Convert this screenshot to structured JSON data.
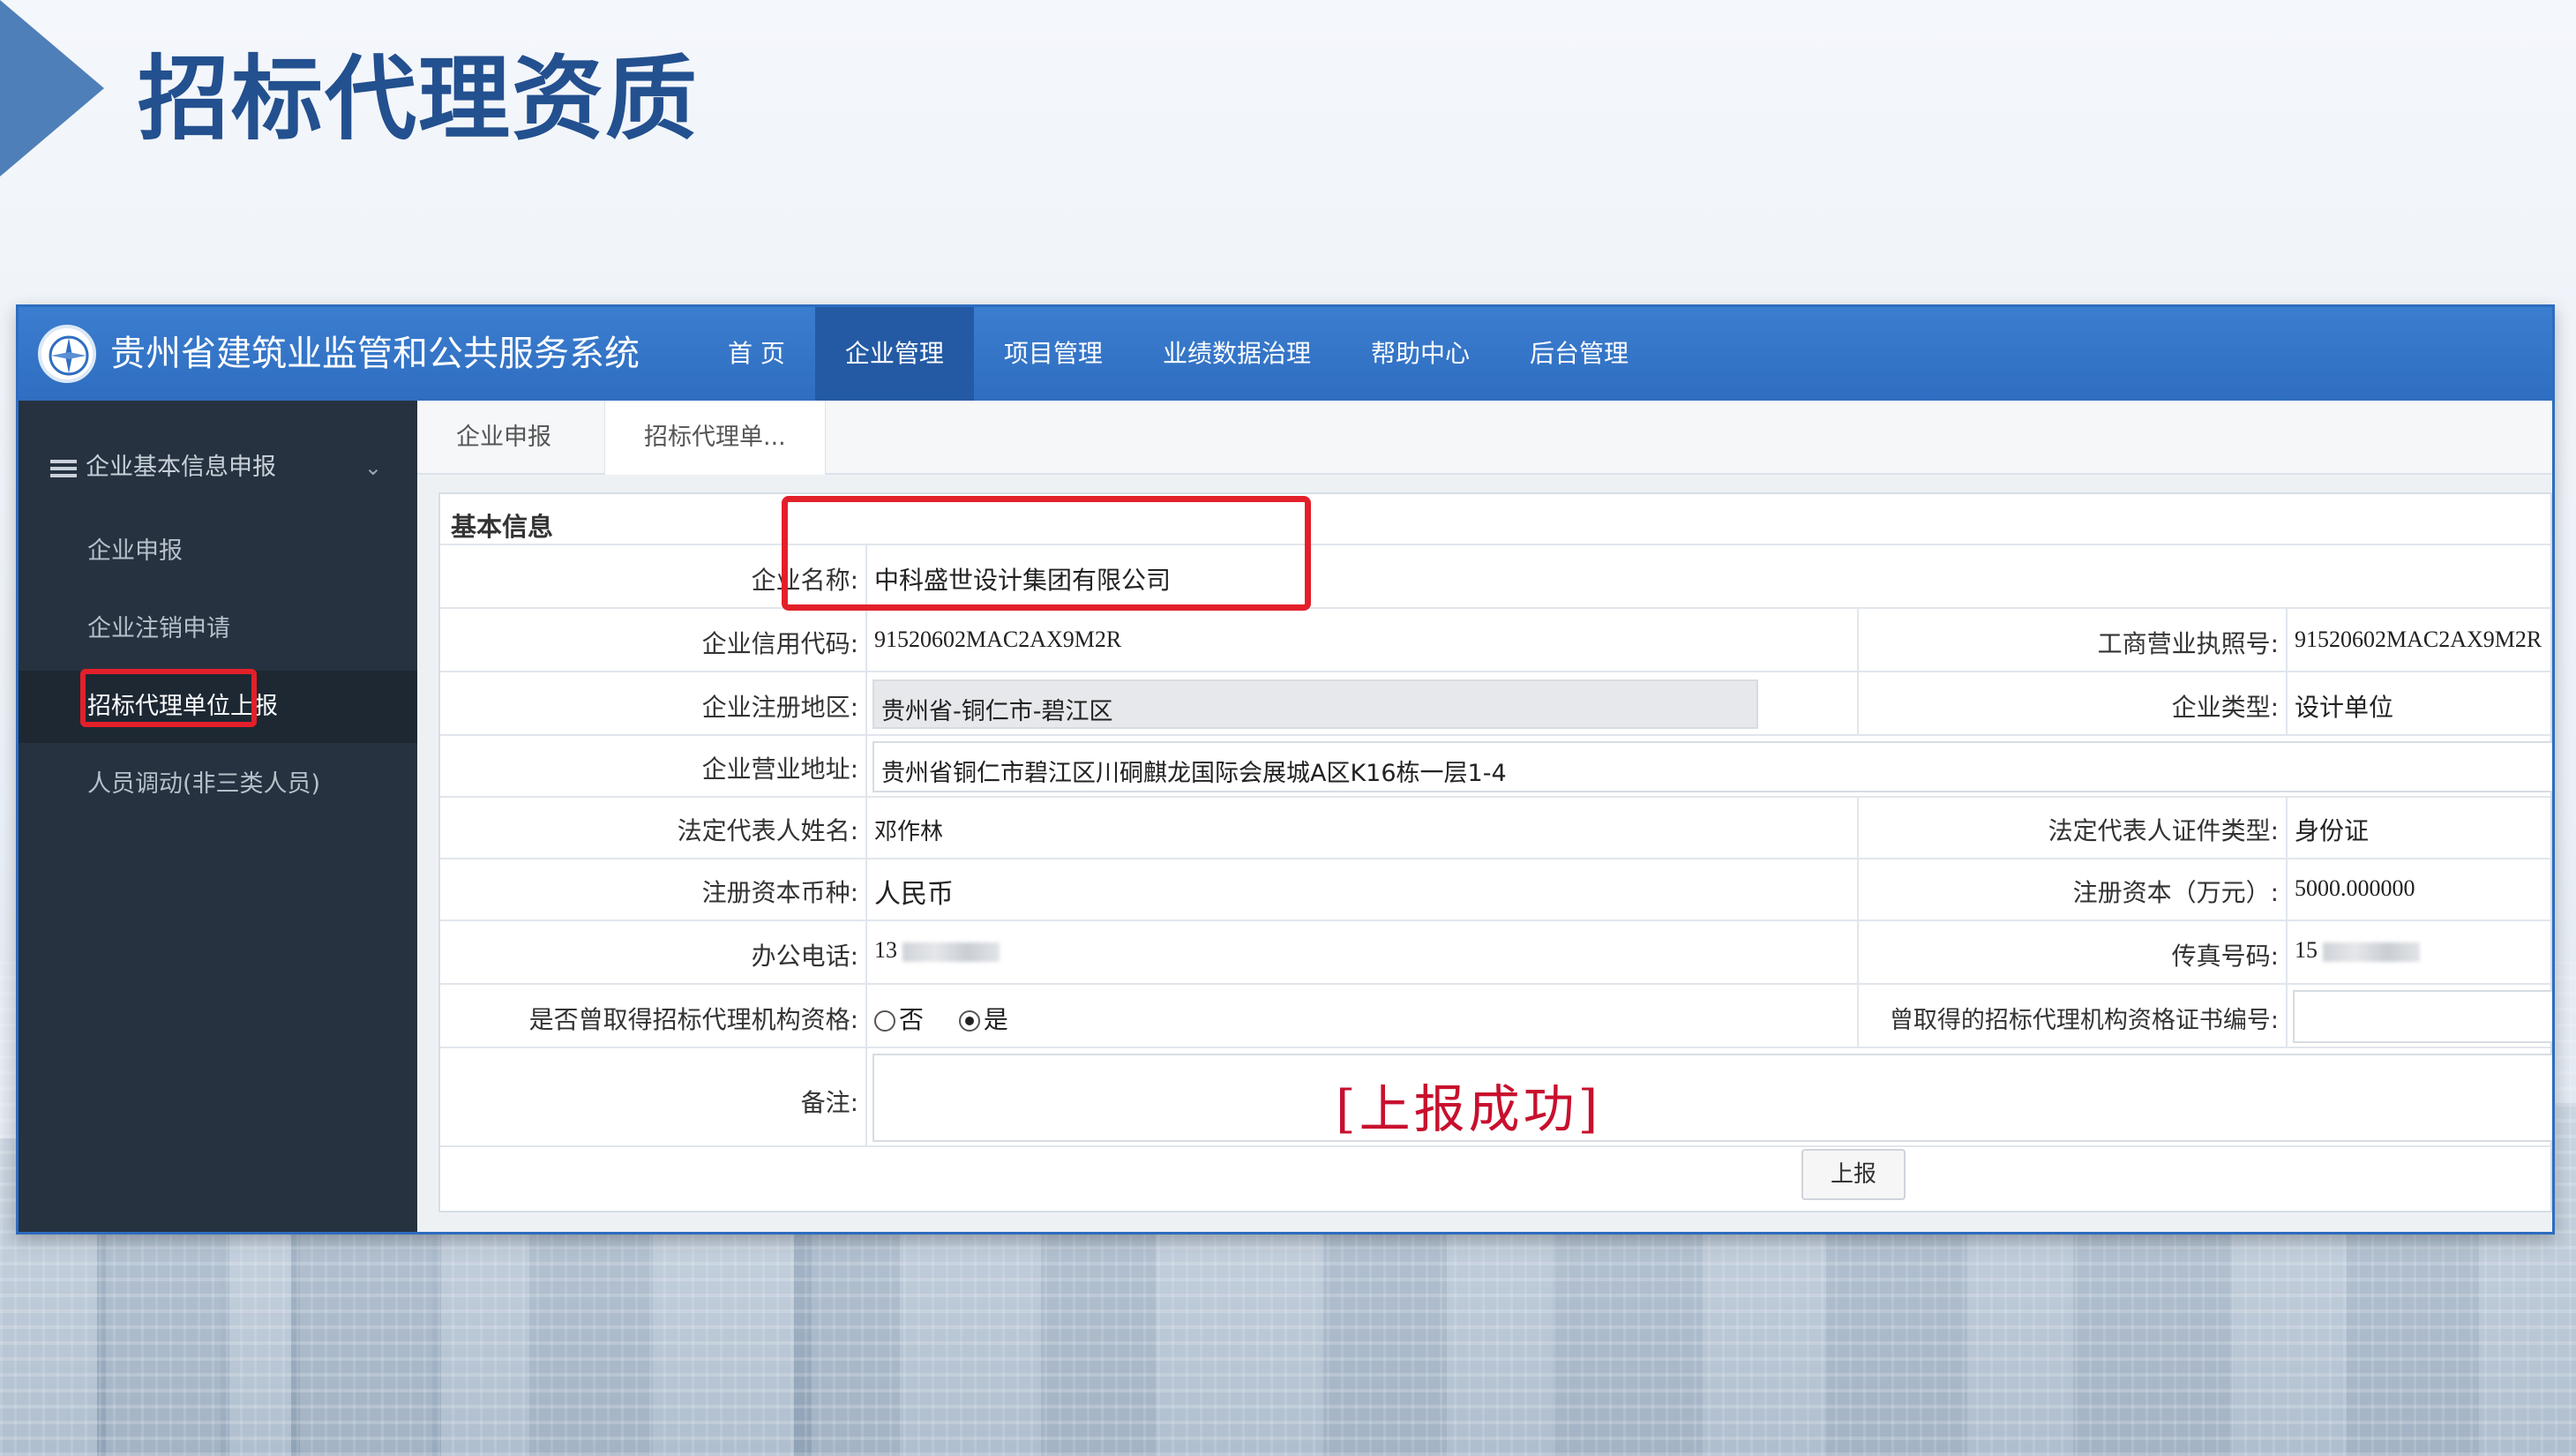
{
  "slide": {
    "title": "招标代理资质"
  },
  "app": {
    "system_title": "贵州省建筑业监管和公共服务系统",
    "nav": [
      "首 页",
      "企业管理",
      "项目管理",
      "业绩数据治理",
      "帮助中心",
      "后台管理"
    ],
    "nav_active": "企业管理"
  },
  "sidebar": {
    "group_label": "企业基本信息申报",
    "items": [
      {
        "label": "企业申报"
      },
      {
        "label": "企业注销申请"
      },
      {
        "label": "招标代理单位上报"
      },
      {
        "label": "人员调动(非三类人员)"
      }
    ],
    "active_item": "招标代理单位上报"
  },
  "tabs": [
    {
      "label": "企业申报"
    },
    {
      "label": "招标代理单..."
    }
  ],
  "form": {
    "section_title": "基本信息",
    "company_name_label": "企业名称:",
    "company_name": "中科盛世设计集团有限公司",
    "credit_code_label": "企业信用代码:",
    "credit_code": "91520602MAC2AX9M2R",
    "license_no_label": "工商营业执照号:",
    "license_no": "91520602MAC2AX9M2R",
    "region_label": "企业注册地区:",
    "region": "贵州省-铜仁市-碧江区",
    "company_type_label": "企业类型:",
    "company_type": "设计单位",
    "address_label": "企业营业地址:",
    "address": "贵州省铜仁市碧江区川硐麒龙国际会展城A区K16栋一层1-4",
    "legal_rep_label": "法定代表人姓名:",
    "legal_rep": "邓作林",
    "id_type_label": "法定代表人证件类型:",
    "id_type": "身份证",
    "currency_label": "注册资本币种:",
    "currency": "人民币",
    "capital_label": "注册资本（万元）:",
    "capital": "5000.000000",
    "phone_label": "办公电话:",
    "phone_prefix": "13",
    "fax_label": "传真号码:",
    "fax_prefix": "15",
    "qualified_label": "是否曾取得招标代理机构资格:",
    "qualified_options": [
      "否",
      "是"
    ],
    "qualified_selected": "是",
    "cert_no_label": "曾取得的招标代理机构资格证书编号:",
    "cert_no": "",
    "remark_label": "备注:",
    "remark": "",
    "submit_label": "上报"
  },
  "annotation": {
    "success_text": "[上报成功]"
  },
  "colors": {
    "header_blue": "#2f6ec0",
    "title_blue": "#23508f",
    "sidebar_dark": "#26323f",
    "highlight_red": "#e3202a",
    "success_red": "#c8102e"
  }
}
